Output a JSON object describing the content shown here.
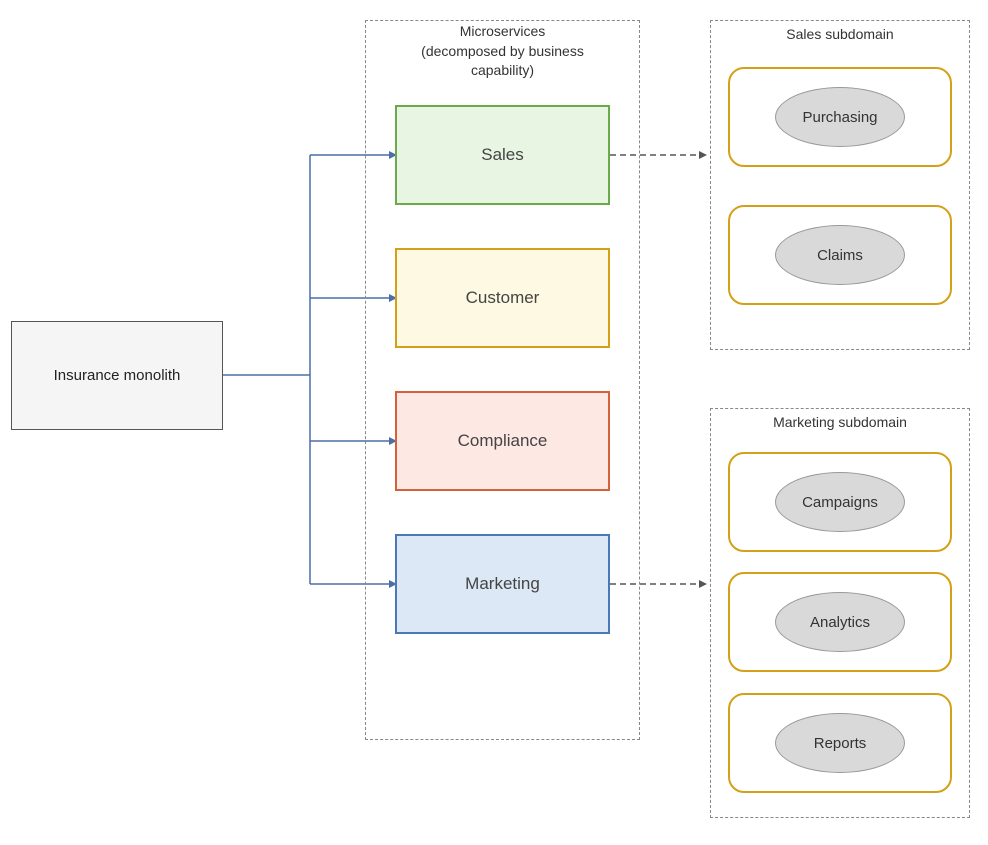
{
  "diagram": {
    "monolith": {
      "label": "Insurance monolith"
    },
    "microservices_title": "Microservices\n(decomposed by business\ncapability)",
    "microservices": [
      {
        "id": "sales",
        "label": "Sales",
        "color_class": "ms-sales"
      },
      {
        "id": "customer",
        "label": "Customer",
        "color_class": "ms-customer"
      },
      {
        "id": "compliance",
        "label": "Compliance",
        "color_class": "ms-compliance"
      },
      {
        "id": "marketing",
        "label": "Marketing",
        "color_class": "ms-marketing"
      }
    ],
    "sales_subdomain": {
      "title": "Sales subdomain",
      "items": [
        {
          "id": "purchasing",
          "label": "Purchasing"
        },
        {
          "id": "claims",
          "label": "Claims"
        }
      ]
    },
    "marketing_subdomain": {
      "title": "Marketing subdomain",
      "items": [
        {
          "id": "campaigns",
          "label": "Campaigns"
        },
        {
          "id": "analytics",
          "label": "Analytics"
        },
        {
          "id": "reports",
          "label": "Reports"
        }
      ]
    }
  }
}
